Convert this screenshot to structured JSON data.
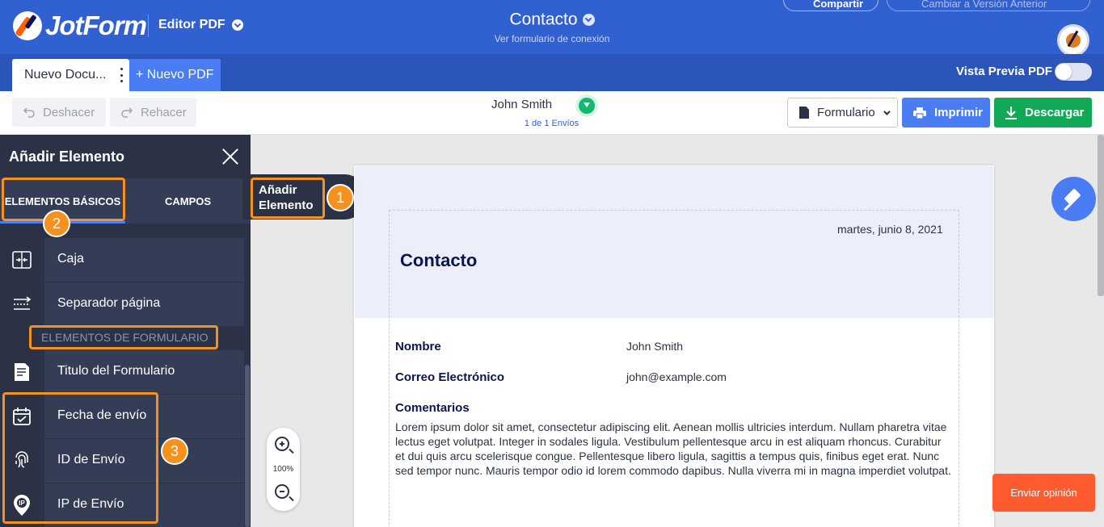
{
  "header": {
    "logo_text": "JotForm",
    "editor_label": "Editor PDF",
    "form_title": "Contacto",
    "form_subtitle": "Ver formulario de conexión",
    "share_label": "Compartir",
    "revert_label": "Cambiar a Versión Anterior"
  },
  "tabs": {
    "doc_label": "Nuevo Docu...",
    "new_pdf_label": "+ Nuevo PDF",
    "preview_label": "Vista Previa PDF",
    "preview_on": false
  },
  "toolbar": {
    "undo_label": "Deshacer",
    "redo_label": "Rehacer",
    "submitter_name": "John Smith",
    "submission_count": "1 de 1 Envíos",
    "form_select_label": "Formulario",
    "print_label": "Imprimir",
    "download_label": "Descargar"
  },
  "sidebar": {
    "title": "Añadir Elemento",
    "tab_basic": "ELEMENTOS BÁSICOS",
    "tab_fields": "CAMPOS",
    "section_label": "ELEMENTOS DE FORMULARIO",
    "items": [
      {
        "label": "Caja",
        "icon": "box-icon"
      },
      {
        "label": "Separador página",
        "icon": "page-break-icon"
      },
      {
        "label": "Titulo del Formulario",
        "icon": "form-title-icon"
      },
      {
        "label": "Fecha de envío",
        "icon": "calendar-icon"
      },
      {
        "label": "ID de Envío",
        "icon": "fingerprint-icon"
      },
      {
        "label": "IP de Envío",
        "icon": "location-ip-icon"
      }
    ]
  },
  "callouts": {
    "tip_label": "Añadir Elemento",
    "badge_1": "1",
    "badge_2": "2",
    "badge_3": "3",
    "accent_color": "#f7911e"
  },
  "document": {
    "date": "martes, junio 8, 2021",
    "title": "Contacto",
    "fields": [
      {
        "label": "Nombre",
        "value": "John Smith"
      },
      {
        "label": "Correo Electrónico",
        "value": "john@example.com"
      }
    ],
    "comments_label": "Comentarios",
    "comments_text": "Lorem ipsum dolor sit amet, consectetur adipiscing elit. Aenean mollis ultricies interdum. Nullam pharetra vitae lectus eget volutpat. Integer in sodales ligula. Vestibulum pellentesque arcu in est aliquam rhoncus. Curabitur et dui quis arcu scelerisque congue. Pellentesque libero ligula, sagittis a tempus quis, finibus eget erat. Nunc sed tempor nunc. Mauris tempor odio id lorem commodo dapibus. Nulla viverra mi in magna imperdiet volutpat."
  },
  "zoom": {
    "level": "100%"
  },
  "feedback_label": "Enviar opinión",
  "colors": {
    "header_blue": "#3160d1",
    "sidebar_navy": "#2b3245",
    "print_blue": "#4a7df4",
    "download_green": "#12a956",
    "feedback_orange": "#ff5a30"
  }
}
